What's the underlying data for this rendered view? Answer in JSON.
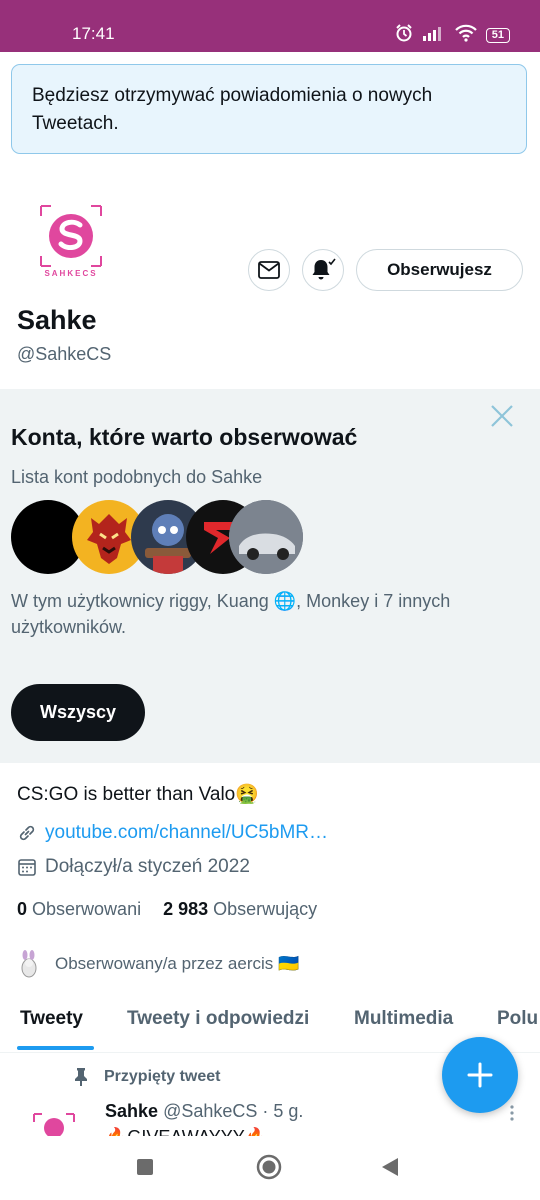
{
  "status_bar": {
    "time": "17:41",
    "battery": "51"
  },
  "notification_banner": {
    "text": "Będziesz otrzymywać powiadomienia o nowych Tweetach."
  },
  "profile": {
    "logo_text": "SAHKECS",
    "name": "Sahke",
    "handle": "@SahkeCS",
    "follow_button": "Obserwujesz",
    "bio": "CS:GO is better than Valo🤮",
    "link": "youtube.com/channel/UC5bMR…",
    "joined": "Dołączył/a styczeń 2022",
    "following_count": "0",
    "following_label": "Obserwowani",
    "followers_count": "2 983",
    "followers_label": "Obserwujący",
    "followed_by": "Obserwowany/a przez aercis 🇺🇦"
  },
  "suggestions": {
    "title": "Konta, które warto obserwować",
    "subtitle": "Lista kont podobnych do Sahke",
    "description": "W tym użytkownicy riggy, Kuang 🌐, Monkey i 7 innych użytkowników.",
    "all_button": "Wszyscy"
  },
  "tabs": [
    {
      "label": "Tweety",
      "active": true
    },
    {
      "label": "Tweety i odpowiedzi",
      "active": false
    },
    {
      "label": "Multimedia",
      "active": false
    },
    {
      "label": "Polu",
      "active": false
    }
  ],
  "pinned_tweet": {
    "label": "Przypięty tweet",
    "author": "Sahke",
    "handle": "@SahkeCS",
    "time": "· 5 g.",
    "text": "🔥GIVEAWAYYY🔥"
  },
  "colors": {
    "status_bar": "#97307a",
    "accent": "#1d9bf0",
    "logo": "#e0479e",
    "banner_bg": "#e8f5fd",
    "suggest_bg": "#eff3f4"
  },
  "icons": [
    "alarm-icon",
    "signal-icon",
    "wifi-icon",
    "battery-icon",
    "mail-icon",
    "bell-check-icon",
    "close-icon",
    "link-icon",
    "calendar-icon",
    "pin-icon",
    "plus-icon",
    "square-nav-icon",
    "home-nav-icon",
    "back-nav-icon"
  ]
}
